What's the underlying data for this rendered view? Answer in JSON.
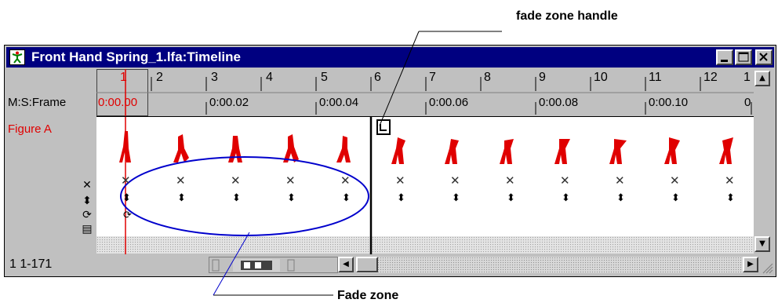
{
  "callouts": {
    "fade_zone_handle": "fade zone handle",
    "fade_zone": "Fade zone"
  },
  "window": {
    "title": "Front Hand Spring_1.lfa:Timeline",
    "title_bg_color": "#000080",
    "controls": [
      "minimize",
      "maximize",
      "close"
    ]
  },
  "left_panel": {
    "row_label": "M:S:Frame",
    "track_label": "Figure A",
    "track_label_color": "#e00000",
    "track_icons": [
      "x-icon",
      "updown-icon",
      "rotate-icon",
      "script-icon"
    ]
  },
  "ruler": {
    "frames": [
      "1",
      "2",
      "3",
      "4",
      "5",
      "6",
      "7",
      "8",
      "9",
      "10",
      "11",
      "12",
      "1"
    ],
    "current_frame": "1",
    "time_labels": [
      "0:00.00",
      "0:00.02",
      "0:00.04",
      "0:00.06",
      "0:00.08",
      "0:00.10",
      "0"
    ],
    "current_time_color": "#e00000"
  },
  "track": {
    "keyframe_marker": "✕",
    "keyframe_arrow": "⬍",
    "figure_color": "#e00000",
    "fade_zone_outline_color": "#0000cc"
  },
  "status": {
    "range": "1 1-171"
  }
}
